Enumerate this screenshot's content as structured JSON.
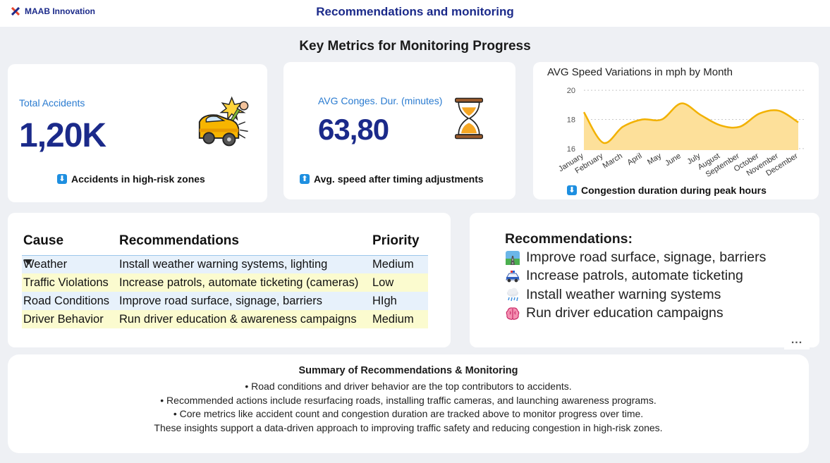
{
  "app": {
    "name": "MAAB Innovation",
    "page_title": "Recommendations and monitoring"
  },
  "section_title": "Key Metrics for Monitoring Progress",
  "kpis": [
    {
      "label": "Total Accidents",
      "value": "1,20K",
      "footer": "Accidents in high-risk zones",
      "footer_arrow": "down",
      "icon": "car-crash-icon"
    },
    {
      "label": "AVG Conges. Dur. (minutes)",
      "value": "63,80",
      "footer": "Avg. speed after timing adjustments",
      "footer_arrow": "up",
      "icon": "hourglass-icon"
    }
  ],
  "speed_card": {
    "footer": "Congestion duration during peak hours",
    "footer_arrow": "down"
  },
  "chart_data": {
    "type": "area",
    "title": "AVG Speed Variations in mph by Month",
    "x": [
      "January",
      "February",
      "March",
      "April",
      "May",
      "June",
      "July",
      "August",
      "September",
      "October",
      "November",
      "December"
    ],
    "series": [
      {
        "values": [
          18.5,
          16.4,
          17.5,
          18.0,
          18.0,
          19.1,
          18.3,
          17.6,
          17.5,
          18.4,
          18.6,
          17.8
        ]
      }
    ],
    "yticks": [
      16,
      18,
      20
    ],
    "ylim": [
      15.9,
      20.1
    ],
    "grid": true,
    "colors": {
      "line": "#f2b100",
      "fill": "#fde09a"
    }
  },
  "table": {
    "headers": [
      "Cause",
      "Recommendations",
      "Priority"
    ],
    "sort_indicator": "down",
    "rows": [
      {
        "cause": "Weather",
        "recommendation": "Install weather warning systems, lighting",
        "priority": "Medium",
        "bg": "#e7f1fb"
      },
      {
        "cause": "Traffic Violations",
        "recommendation": "Increase patrols, automate ticketing (cameras)",
        "priority": "Low",
        "bg": "#fbfbcf"
      },
      {
        "cause": "Road Conditions",
        "recommendation": "Improve road surface, signage, barriers",
        "priority": "HIgh",
        "bg": "#e7f1fb"
      },
      {
        "cause": "Driver Behavior",
        "recommendation": "Run driver education & awareness campaigns",
        "priority": "Medium",
        "bg": "#fbfbcf"
      }
    ]
  },
  "recommendations": {
    "title": "Recommendations:",
    "items": [
      {
        "text": "Improve road surface, signage, barriers",
        "icon": "road-icon"
      },
      {
        "text": "Increase patrols, automate ticketing",
        "icon": "police-car-icon"
      },
      {
        "text": "Install weather warning systems",
        "icon": "rain-cloud-icon"
      },
      {
        "text": "Run driver education campaigns",
        "icon": "brain-icon"
      }
    ],
    "more_label": "..."
  },
  "summary": {
    "title": "Summary of Recommendations & Monitoring",
    "lines": [
      "• Road conditions and driver behavior are the top contributors to accidents.",
      "• Recommended actions include resurfacing roads, installing traffic cameras, and launching awareness programs.",
      "• Core metrics like accident count and congestion duration are tracked above to monitor progress over time.",
      "These insights support a data-driven approach to improving traffic safety and reducing congestion in high-risk zones."
    ]
  },
  "colors": {
    "brand": "#1b2a8a",
    "accent": "#2a7bd0",
    "background": "#eef0f4"
  }
}
